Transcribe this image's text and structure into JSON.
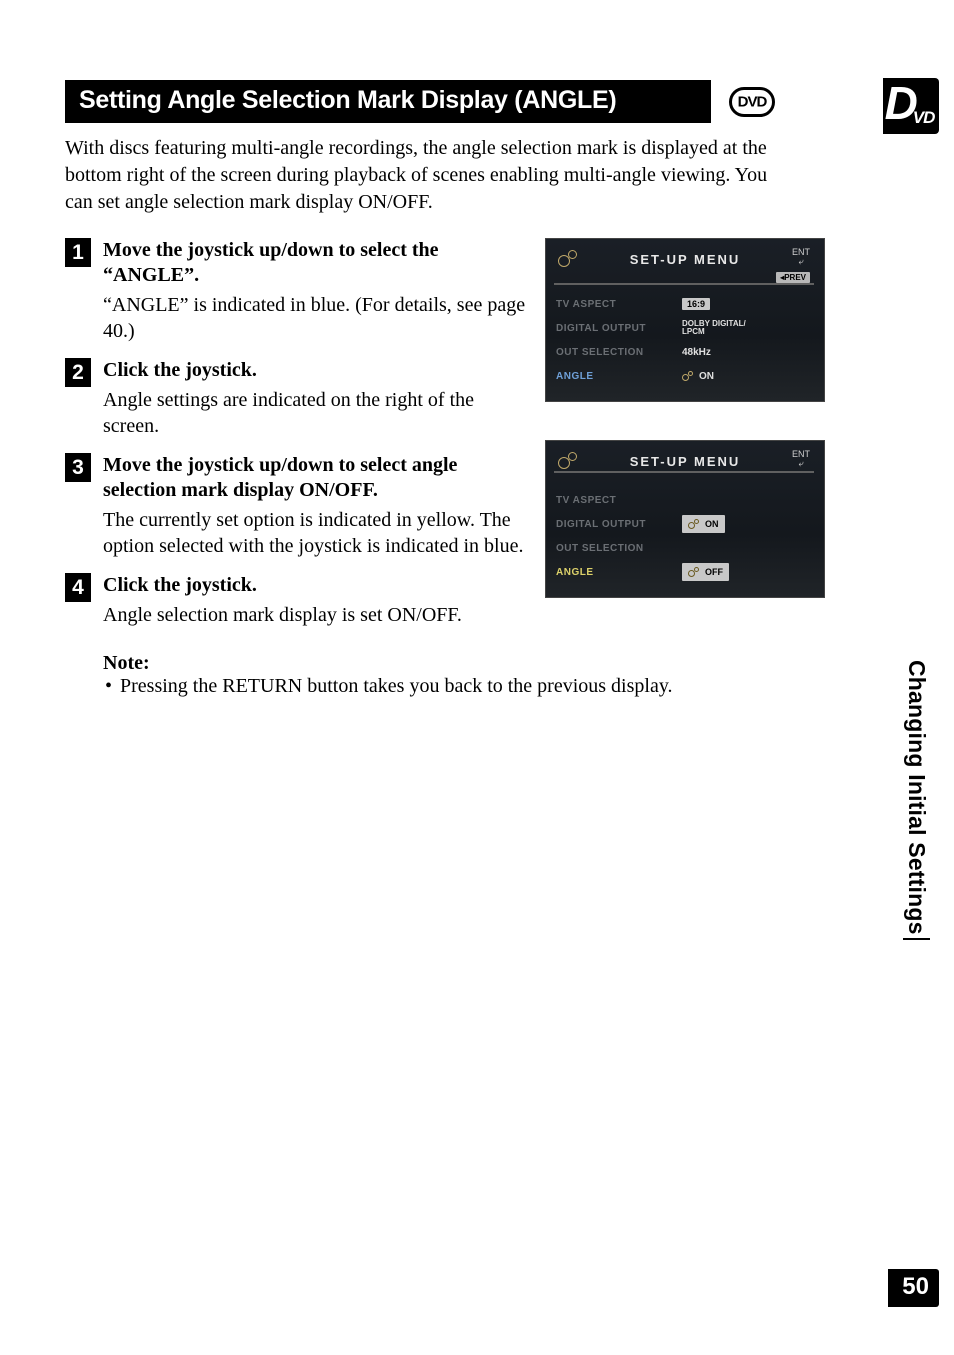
{
  "sideTab": {
    "d": "D",
    "vd": "VD"
  },
  "sideLabel": "Changing Initial Settings",
  "pageNumber": "50",
  "header": {
    "title": "Setting Angle Selection Mark Display (ANGLE)"
  },
  "intro": "With discs featuring multi-angle recordings, the angle selection mark is displayed at the bottom right of the screen during playback of scenes enabling multi-angle viewing. You can set angle selection mark display ON/OFF.",
  "steps": [
    {
      "num": "1",
      "title": "Move the joystick up/down to select the “ANGLE”.",
      "desc": "“ANGLE” is indicated in blue. (For details, see page 40.)"
    },
    {
      "num": "2",
      "title": "Click the joystick.",
      "desc": "Angle settings are indicated on the right of the screen."
    },
    {
      "num": "3",
      "title": "Move the joystick up/down to select angle selection mark display ON/OFF.",
      "desc": "The currently set option is indicated in yellow. The option selected with the joystick is indicated in blue."
    },
    {
      "num": "4",
      "title": "Click the joystick.",
      "desc": "Angle selection mark display is set ON/OFF."
    }
  ],
  "note": {
    "title": "Note:",
    "bullet": "Pressing the RETURN button takes you back to the previous display."
  },
  "menu": {
    "title": "SET-UP MENU",
    "ent": "ENT",
    "prev": "◂PREV",
    "panel1": {
      "rows": [
        {
          "label": "TV ASPECT",
          "valueBox": "16:9"
        },
        {
          "label": "DIGITAL OUTPUT",
          "valueText": "DOLBY DIGITAL/\nLPCM"
        },
        {
          "label": "OUT SELECTION",
          "valueText": "48kHz"
        },
        {
          "label": "ANGLE",
          "gear": true,
          "valueText": "ON",
          "active": true
        }
      ]
    },
    "panel2": {
      "rows": [
        {
          "label": "TV ASPECT"
        },
        {
          "label": "DIGITAL OUTPUT",
          "optBox": "ON",
          "optGear": true,
          "active": true
        },
        {
          "label": "OUT SELECTION"
        },
        {
          "label": "ANGLE",
          "optBox": "OFF",
          "optGear": true,
          "sel": true
        }
      ]
    }
  }
}
